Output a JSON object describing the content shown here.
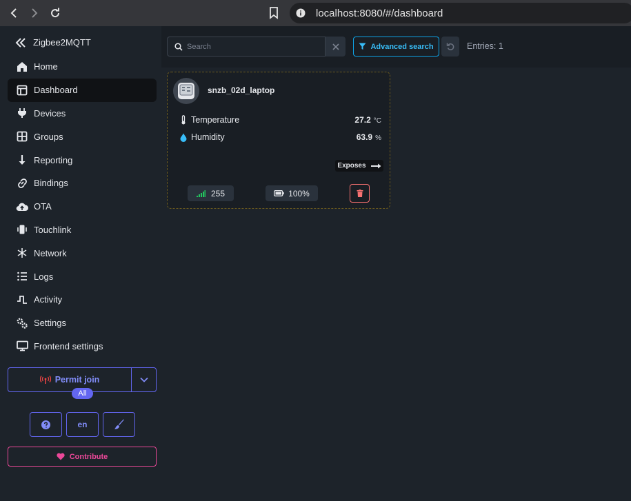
{
  "browser": {
    "url": "localhost:8080/#/dashboard"
  },
  "sidebar": {
    "brand": "Zigbee2MQTT",
    "items": [
      {
        "label": "Home",
        "icon": "home-icon"
      },
      {
        "label": "Dashboard",
        "icon": "dashboard-icon",
        "active": true
      },
      {
        "label": "Devices",
        "icon": "plug-icon"
      },
      {
        "label": "Groups",
        "icon": "grid-icon"
      },
      {
        "label": "Reporting",
        "icon": "arrow-down-icon"
      },
      {
        "label": "Bindings",
        "icon": "link-icon"
      },
      {
        "label": "OTA",
        "icon": "cloud-upload-icon"
      },
      {
        "label": "Touchlink",
        "icon": "touchlink-icon"
      },
      {
        "label": "Network",
        "icon": "network-icon"
      },
      {
        "label": "Logs",
        "icon": "list-icon"
      },
      {
        "label": "Activity",
        "icon": "activity-icon"
      },
      {
        "label": "Settings",
        "icon": "gears-icon"
      },
      {
        "label": "Frontend settings",
        "icon": "monitor-icon"
      }
    ],
    "permit_join": "Permit join",
    "permit_target": "All",
    "language": "en",
    "contribute": "Contribute"
  },
  "toolbar": {
    "search_placeholder": "Search",
    "advanced_search": "Advanced search",
    "entries": "Entries: 1"
  },
  "device": {
    "name": "snzb_02d_laptop",
    "features": [
      {
        "label": "Temperature",
        "value": "27.2",
        "unit": "°C",
        "icon": "thermometer-icon"
      },
      {
        "label": "Humidity",
        "value": "63.9",
        "unit": "%",
        "icon": "droplet-icon"
      }
    ],
    "exposes": "Exposes",
    "linkquality": "255",
    "battery": "100%"
  },
  "colors": {
    "accent": "#6366f1",
    "info": "#0ea5e9",
    "contribute": "#ec4899",
    "danger": "#f87171",
    "signal": "#22c55e"
  }
}
